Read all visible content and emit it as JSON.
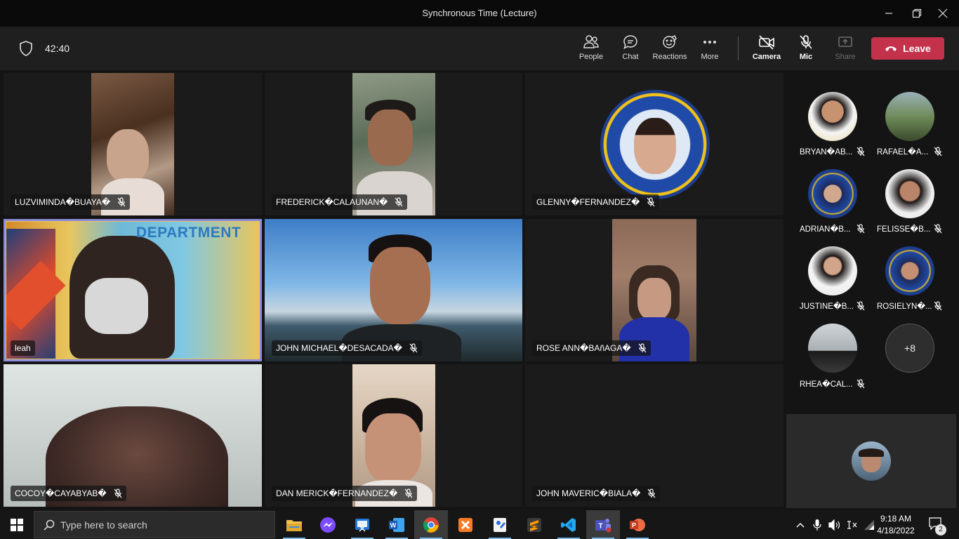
{
  "window": {
    "title": "Synchronous Time (Lecture)"
  },
  "toolbar": {
    "timer": "42:40",
    "buttons": {
      "people": "People",
      "chat": "Chat",
      "reactions": "Reactions",
      "more": "More",
      "camera": "Camera",
      "mic": "Mic",
      "share": "Share"
    },
    "leave_label": "Leave",
    "leave_color": "#c4314b"
  },
  "participants": [
    {
      "name": "LUZVIMINDA�BUAYA�",
      "muted": true
    },
    {
      "name": "FREDERICK�CALAUNAN�",
      "muted": true
    },
    {
      "name": "GLENNY�FERNANDEZ�",
      "muted": true
    },
    {
      "name": "leah",
      "muted": false,
      "speaking": true
    },
    {
      "name": "JOHN MICHAEL�DESACADA�",
      "muted": true
    },
    {
      "name": "ROSE ANN�BAñAGA�",
      "muted": true
    },
    {
      "name": "COCOY�CAYABYAB�",
      "muted": true
    },
    {
      "name": "DAN MERICK�FERNANDEZ�",
      "muted": true
    },
    {
      "name": "JOHN MAVERIC�BIALA�",
      "muted": true
    }
  ],
  "video_overlay_text": "DEPARTMENT",
  "roster": [
    {
      "name": "BRYAN�AB...",
      "muted": true
    },
    {
      "name": "RAFAEL�A...",
      "muted": true
    },
    {
      "name": "ADRIAN�B...",
      "muted": true
    },
    {
      "name": "FELISSE�B...",
      "muted": true
    },
    {
      "name": "JUSTINE�B...",
      "muted": true
    },
    {
      "name": "ROSIELYN�...",
      "muted": true
    },
    {
      "name": "RHEA�CAL...",
      "muted": true
    }
  ],
  "roster_overflow": "+8",
  "taskbar": {
    "search_placeholder": "Type here to search",
    "apps": [
      "file-explorer-icon",
      "messenger-icon",
      "snipping-tool-icon",
      "word-icon",
      "chrome-icon",
      "xampp-icon",
      "paint-icon",
      "sublime-text-icon",
      "vscode-icon",
      "teams-icon",
      "powerpoint-icon"
    ],
    "time": "9:18 AM",
    "date": "4/18/2022",
    "notifications": "2"
  },
  "colors": {
    "accent_outline": "#8b8cdb",
    "taskbar_indicator": "#76b9ed"
  }
}
